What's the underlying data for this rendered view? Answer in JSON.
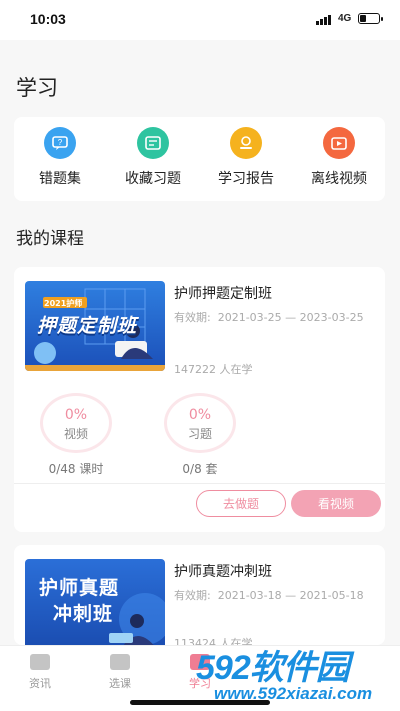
{
  "status_bar": {
    "time": "10:03",
    "network": "4G",
    "battery_level": 0.35
  },
  "page": {
    "title": "学习"
  },
  "quick_actions": [
    {
      "label": "错题集",
      "icon": "wrong-questions-icon",
      "color": "#3aa3f0"
    },
    {
      "label": "收藏习题",
      "icon": "favorite-questions-icon",
      "color": "#2ec4a0"
    },
    {
      "label": "学习报告",
      "icon": "study-report-icon",
      "color": "#f5b21e"
    },
    {
      "label": "离线视频",
      "icon": "offline-video-icon",
      "color": "#f4683f"
    }
  ],
  "my_courses": {
    "title": "我的课程",
    "courses": [
      {
        "cover_badge": "2021护师",
        "cover_title": "押题定制班",
        "name": "护师押题定制班",
        "valid_label": "有效期:",
        "valid_range": "2021-03-25 — 2023-03-25",
        "learners": "147222 人在学",
        "video_progress": "0%",
        "video_label": "视频",
        "video_count": "0/48 课时",
        "exercise_progress": "0%",
        "exercise_label": "习题",
        "exercise_count": "0/8 套",
        "btn_practice": "去做题",
        "btn_video": "看视频"
      },
      {
        "cover_title_1": "护师真题",
        "cover_title_2": "冲刺班",
        "name": "护师真题冲刺班",
        "valid_label": "有效期:",
        "valid_range": "2021-03-18 — 2021-05-18",
        "learners": "113424 人在学"
      }
    ]
  },
  "tabbar": [
    {
      "label": "资讯",
      "icon": "news-icon"
    },
    {
      "label": "选课",
      "icon": "course-select-icon"
    },
    {
      "label": "学习",
      "icon": "study-icon",
      "active": true
    }
  ],
  "watermark": {
    "brand": "592软件园",
    "url": "www.592xiazai.com"
  },
  "colors": {
    "accent": "#ef8da0",
    "button_fill": "#f3a3b4",
    "cover_blue": "#1d62c9"
  }
}
